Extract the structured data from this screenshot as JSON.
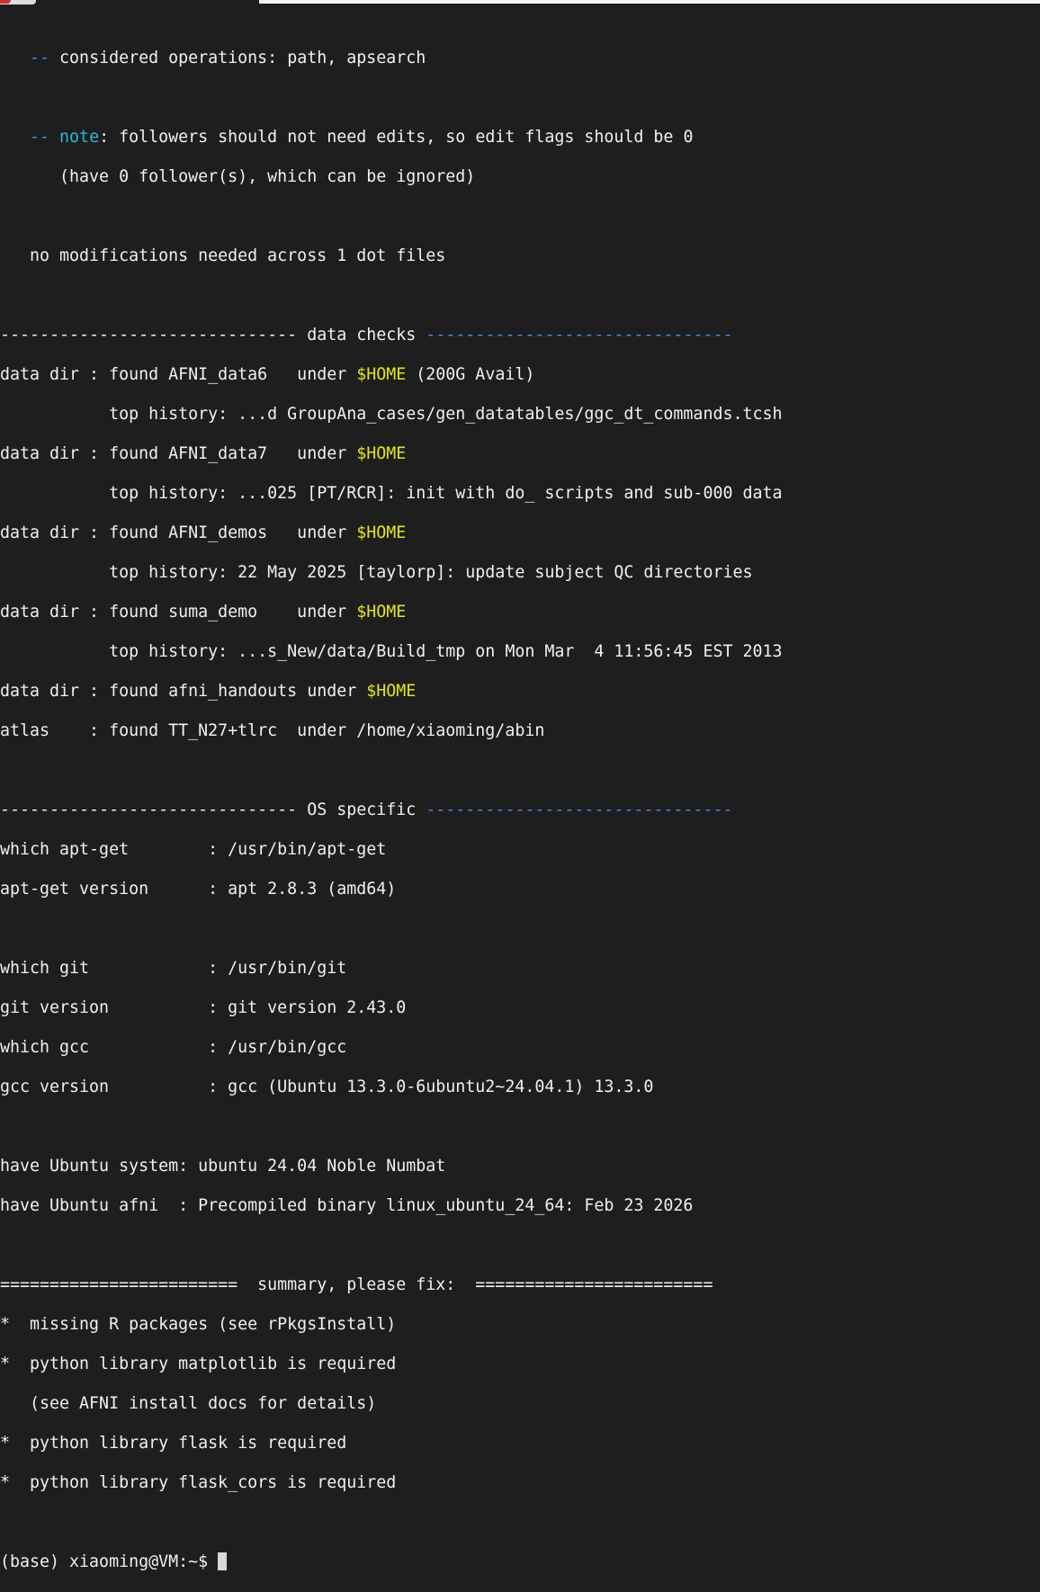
{
  "terminal": {
    "ops_prefix": "   -- ",
    "ops_text": "considered operations: path, apsearch",
    "note_prefix": "   -- ",
    "note_label": "note",
    "note_text": ": followers should not need edits, so edit flags should be 0",
    "note_text2": "      (have 0 follower(s), which can be ignored)",
    "nomod": "   no modifications needed across 1 dot files",
    "data_checks": {
      "left_rule": "------------------------------ data checks ",
      "right_rule": "-------------------------------",
      "home_var": "$HOME",
      "rows": [
        {
          "pre": "data dir : found AFNI_data6   under ",
          "post": " (200G Avail)"
        },
        {
          "plain": "           top history: ...d GroupAna_cases/gen_datatables/ggc_dt_commands.tcsh"
        },
        {
          "pre": "data dir : found AFNI_data7   under ",
          "post": ""
        },
        {
          "plain": "           top history: ...025 [PT/RCR]: init with do_ scripts and sub-000 data"
        },
        {
          "pre": "data dir : found AFNI_demos   under ",
          "post": ""
        },
        {
          "plain": "           top history: 22 May 2025 [taylorp]: update subject QC directories"
        },
        {
          "pre": "data dir : found suma_demo    under ",
          "post": ""
        },
        {
          "plain": "           top history: ...s_New/data/Build_tmp on Mon Mar  4 11:56:45 EST 2013"
        },
        {
          "pre": "data dir : found afni_handouts under ",
          "post": ""
        },
        {
          "plain": "atlas    : found TT_N27+tlrc  under /home/xiaoming/abin"
        }
      ]
    },
    "os_specific": {
      "left_rule": "------------------------------ OS specific ",
      "right_rule": "-------------------------------",
      "lines": [
        "which apt-get        : /usr/bin/apt-get",
        "apt-get version      : apt 2.8.3 (amd64)",
        "",
        "which git            : /usr/bin/git",
        "git version          : git version 2.43.0",
        "which gcc            : /usr/bin/gcc",
        "gcc version          : gcc (Ubuntu 13.3.0-6ubuntu2~24.04.1) 13.3.0",
        "",
        "have Ubuntu system: ubuntu 24.04 Noble Numbat",
        "have Ubuntu afni  : Precompiled binary linux_ubuntu_24_64: Feb 23 2026"
      ]
    },
    "summary": {
      "header": "========================  summary, please fix:  ========================",
      "items": [
        "*  missing R packages (see rPkgsInstall)",
        "*  python library matplotlib is required",
        "   (see AFNI install docs for details)",
        "*  python library flask is required",
        "*  python library flask_cors is required"
      ]
    },
    "prompt": "(base) xiaoming@VM:~$ "
  },
  "colors": {
    "background": "#1e1e1e",
    "foreground": "#f0f0f0",
    "blue": "#3b8eea",
    "cyan": "#29b8db",
    "yellow": "#e5e510"
  }
}
